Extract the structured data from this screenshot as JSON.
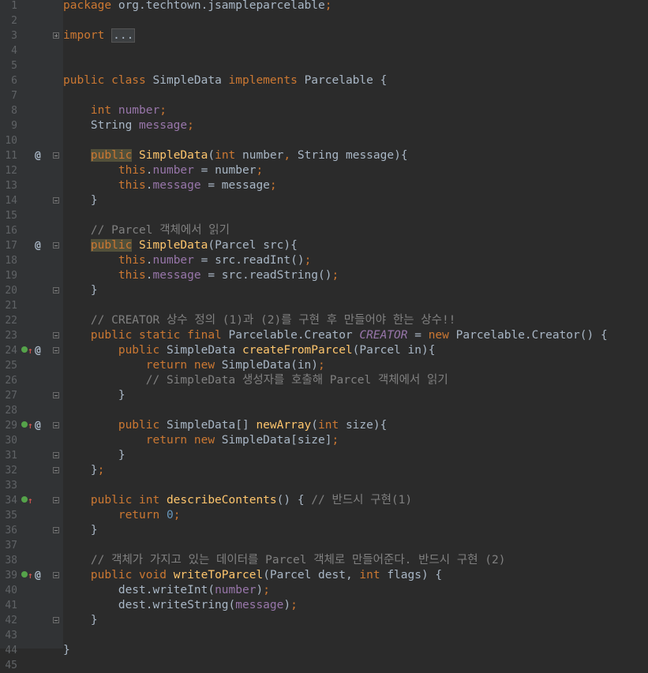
{
  "editor": {
    "language": "java",
    "colors": {
      "background": "#2b2b2b",
      "gutter": "#313335",
      "keyword": "#cc7832",
      "field": "#9876aa",
      "method": "#ffc66d",
      "number": "#6897bb",
      "comment": "#808080",
      "text": "#a9b7c6"
    },
    "gutter_icons": {
      "override": "override-marker-icon",
      "annotation": "at-sign-icon",
      "fold": "fold-toggle-icon"
    },
    "lines": [
      {
        "n": "1",
        "fold": null,
        "marks": [],
        "tokens": [
          {
            "t": "package ",
            "c": "kw"
          },
          {
            "t": "org.techtown.jsampleparcelable",
            "c": "df"
          },
          {
            "t": ";",
            "c": "kw"
          }
        ]
      },
      {
        "n": "2",
        "fold": null,
        "marks": [],
        "tokens": []
      },
      {
        "n": "3",
        "fold": "plus",
        "marks": [],
        "tokens": [
          {
            "t": "import ",
            "c": "kw"
          },
          {
            "t": "...",
            "c": "foldbox"
          }
        ]
      },
      {
        "n": "4",
        "fold": null,
        "marks": [],
        "tokens": []
      },
      {
        "n": "5",
        "fold": null,
        "marks": [],
        "tokens": []
      },
      {
        "n": "6",
        "fold": null,
        "marks": [],
        "tokens": [
          {
            "t": "public class ",
            "c": "kw"
          },
          {
            "t": "SimpleData ",
            "c": "df"
          },
          {
            "t": "implements ",
            "c": "kw"
          },
          {
            "t": "Parcelable {",
            "c": "df"
          }
        ]
      },
      {
        "n": "7",
        "fold": null,
        "marks": [],
        "tokens": []
      },
      {
        "n": "8",
        "fold": null,
        "marks": [],
        "tokens": [
          {
            "t": "    int ",
            "c": "kw"
          },
          {
            "t": "number",
            "c": "fld"
          },
          {
            "t": ";",
            "c": "kw"
          }
        ]
      },
      {
        "n": "9",
        "fold": null,
        "marks": [],
        "tokens": [
          {
            "t": "    String ",
            "c": "df"
          },
          {
            "t": "message",
            "c": "fld"
          },
          {
            "t": ";",
            "c": "kw"
          }
        ]
      },
      {
        "n": "10",
        "fold": null,
        "marks": [],
        "tokens": []
      },
      {
        "n": "11",
        "fold": "open",
        "marks": [
          "at"
        ],
        "tokens": [
          {
            "t": "    ",
            "c": "df"
          },
          {
            "t": "public",
            "c": "kw hl"
          },
          {
            "t": " ",
            "c": "df"
          },
          {
            "t": "SimpleData",
            "c": "fn"
          },
          {
            "t": "(",
            "c": "df"
          },
          {
            "t": "int ",
            "c": "kw"
          },
          {
            "t": "number",
            "c": "df"
          },
          {
            "t": ", ",
            "c": "kw"
          },
          {
            "t": "String message){",
            "c": "df"
          }
        ]
      },
      {
        "n": "12",
        "fold": null,
        "marks": [],
        "tokens": [
          {
            "t": "        this",
            "c": "kw"
          },
          {
            "t": ".",
            "c": "df"
          },
          {
            "t": "number",
            "c": "fld"
          },
          {
            "t": " = number",
            "c": "df"
          },
          {
            "t": ";",
            "c": "kw"
          }
        ]
      },
      {
        "n": "13",
        "fold": null,
        "marks": [],
        "tokens": [
          {
            "t": "        this",
            "c": "kw"
          },
          {
            "t": ".",
            "c": "df"
          },
          {
            "t": "message",
            "c": "fld"
          },
          {
            "t": " = message",
            "c": "df"
          },
          {
            "t": ";",
            "c": "kw"
          }
        ]
      },
      {
        "n": "14",
        "fold": "close",
        "marks": [],
        "tokens": [
          {
            "t": "    }",
            "c": "df"
          }
        ]
      },
      {
        "n": "15",
        "fold": null,
        "marks": [],
        "tokens": []
      },
      {
        "n": "16",
        "fold": null,
        "marks": [],
        "tokens": [
          {
            "t": "    // Parcel 객체에서 읽기",
            "c": "cm"
          }
        ]
      },
      {
        "n": "17",
        "fold": "open",
        "marks": [
          "at"
        ],
        "tokens": [
          {
            "t": "    ",
            "c": "df"
          },
          {
            "t": "public",
            "c": "kw hl"
          },
          {
            "t": " ",
            "c": "df"
          },
          {
            "t": "SimpleData",
            "c": "fn"
          },
          {
            "t": "(Parcel src){",
            "c": "df"
          }
        ]
      },
      {
        "n": "18",
        "fold": null,
        "marks": [],
        "tokens": [
          {
            "t": "        this",
            "c": "kw"
          },
          {
            "t": ".",
            "c": "df"
          },
          {
            "t": "number",
            "c": "fld"
          },
          {
            "t": " = src.readInt()",
            "c": "df"
          },
          {
            "t": ";",
            "c": "kw"
          }
        ]
      },
      {
        "n": "19",
        "fold": null,
        "marks": [],
        "tokens": [
          {
            "t": "        this",
            "c": "kw"
          },
          {
            "t": ".",
            "c": "df"
          },
          {
            "t": "message",
            "c": "fld"
          },
          {
            "t": " = src.readString()",
            "c": "df"
          },
          {
            "t": ";",
            "c": "kw"
          }
        ]
      },
      {
        "n": "20",
        "fold": "close",
        "marks": [],
        "tokens": [
          {
            "t": "    }",
            "c": "df"
          }
        ]
      },
      {
        "n": "21",
        "fold": null,
        "marks": [],
        "tokens": []
      },
      {
        "n": "22",
        "fold": null,
        "marks": [],
        "tokens": [
          {
            "t": "    // CREATOR 상수 정의 (1)과 (2)를 구현 후 만들어야 한는 상수!!",
            "c": "cm"
          }
        ]
      },
      {
        "n": "23",
        "fold": "open",
        "marks": [],
        "tokens": [
          {
            "t": "    public static final ",
            "c": "kw"
          },
          {
            "t": "Parcelable.Creator ",
            "c": "df"
          },
          {
            "t": "CREATOR",
            "c": "fldi"
          },
          {
            "t": " = ",
            "c": "df"
          },
          {
            "t": "new ",
            "c": "kw"
          },
          {
            "t": "Parcelable.Creator() {",
            "c": "df"
          }
        ]
      },
      {
        "n": "24",
        "fold": "open",
        "marks": [
          "o",
          "u",
          "at"
        ],
        "tokens": [
          {
            "t": "        public ",
            "c": "kw"
          },
          {
            "t": "SimpleData ",
            "c": "df"
          },
          {
            "t": "createFromParcel",
            "c": "fn"
          },
          {
            "t": "(Parcel in){",
            "c": "df"
          }
        ]
      },
      {
        "n": "25",
        "fold": null,
        "marks": [],
        "tokens": [
          {
            "t": "            return new ",
            "c": "kw"
          },
          {
            "t": "SimpleData(in)",
            "c": "df"
          },
          {
            "t": ";",
            "c": "kw"
          }
        ]
      },
      {
        "n": "26",
        "fold": null,
        "marks": [],
        "tokens": [
          {
            "t": "            // SimpleData 생성자를 호출해 Parcel 객체에서 읽기",
            "c": "cm"
          }
        ]
      },
      {
        "n": "27",
        "fold": "close",
        "marks": [],
        "tokens": [
          {
            "t": "        }",
            "c": "df"
          }
        ]
      },
      {
        "n": "28",
        "fold": null,
        "marks": [],
        "tokens": []
      },
      {
        "n": "29",
        "fold": "open",
        "marks": [
          "o",
          "u",
          "at"
        ],
        "tokens": [
          {
            "t": "        public ",
            "c": "kw"
          },
          {
            "t": "SimpleData[] ",
            "c": "df"
          },
          {
            "t": "newArray",
            "c": "fn"
          },
          {
            "t": "(",
            "c": "df"
          },
          {
            "t": "int ",
            "c": "kw"
          },
          {
            "t": "size){",
            "c": "df"
          }
        ]
      },
      {
        "n": "30",
        "fold": null,
        "marks": [],
        "tokens": [
          {
            "t": "            return new ",
            "c": "kw"
          },
          {
            "t": "SimpleData[size]",
            "c": "df"
          },
          {
            "t": ";",
            "c": "kw"
          }
        ]
      },
      {
        "n": "31",
        "fold": "close",
        "marks": [],
        "tokens": [
          {
            "t": "        }",
            "c": "df"
          }
        ]
      },
      {
        "n": "32",
        "fold": "close",
        "marks": [],
        "tokens": [
          {
            "t": "    }",
            "c": "df"
          },
          {
            "t": ";",
            "c": "kw"
          }
        ]
      },
      {
        "n": "33",
        "fold": null,
        "marks": [],
        "tokens": []
      },
      {
        "n": "34",
        "fold": "open",
        "marks": [
          "o",
          "u"
        ],
        "tokens": [
          {
            "t": "    public int ",
            "c": "kw"
          },
          {
            "t": "describeContents",
            "c": "fn"
          },
          {
            "t": "() { ",
            "c": "df"
          },
          {
            "t": "// 반드시 구현(1)",
            "c": "cm"
          }
        ]
      },
      {
        "n": "35",
        "fold": null,
        "marks": [],
        "tokens": [
          {
            "t": "        return ",
            "c": "kw"
          },
          {
            "t": "0",
            "c": "num"
          },
          {
            "t": ";",
            "c": "kw"
          }
        ]
      },
      {
        "n": "36",
        "fold": "close",
        "marks": [],
        "tokens": [
          {
            "t": "    }",
            "c": "df"
          }
        ]
      },
      {
        "n": "37",
        "fold": null,
        "marks": [],
        "tokens": []
      },
      {
        "n": "38",
        "fold": null,
        "marks": [],
        "tokens": [
          {
            "t": "    // 객체가 가지고 있는 데이터를 Parcel 객체로 만들어준다. 반드시 구현 (2)",
            "c": "cm"
          }
        ]
      },
      {
        "n": "39",
        "fold": "open",
        "marks": [
          "o",
          "u",
          "at"
        ],
        "tokens": [
          {
            "t": "    public void ",
            "c": "kw"
          },
          {
            "t": "writeToParcel",
            "c": "fn"
          },
          {
            "t": "(Parcel dest, ",
            "c": "df"
          },
          {
            "t": "int ",
            "c": "kw"
          },
          {
            "t": "flags) {",
            "c": "df"
          }
        ]
      },
      {
        "n": "40",
        "fold": null,
        "marks": [],
        "tokens": [
          {
            "t": "        dest.writeInt(",
            "c": "df"
          },
          {
            "t": "number",
            "c": "fld"
          },
          {
            "t": ")",
            "c": "df"
          },
          {
            "t": ";",
            "c": "kw"
          }
        ]
      },
      {
        "n": "41",
        "fold": null,
        "marks": [],
        "tokens": [
          {
            "t": "        dest.writeString(",
            "c": "df"
          },
          {
            "t": "message",
            "c": "fld"
          },
          {
            "t": ")",
            "c": "df"
          },
          {
            "t": ";",
            "c": "kw"
          }
        ]
      },
      {
        "n": "42",
        "fold": "close",
        "marks": [],
        "tokens": [
          {
            "t": "    }",
            "c": "df"
          }
        ]
      },
      {
        "n": "43",
        "fold": null,
        "marks": [],
        "tokens": []
      },
      {
        "n": "44",
        "fold": null,
        "marks": [],
        "tokens": [
          {
            "t": "}",
            "c": "df"
          }
        ]
      },
      {
        "n": "45",
        "fold": null,
        "marks": [],
        "tokens": []
      }
    ]
  }
}
